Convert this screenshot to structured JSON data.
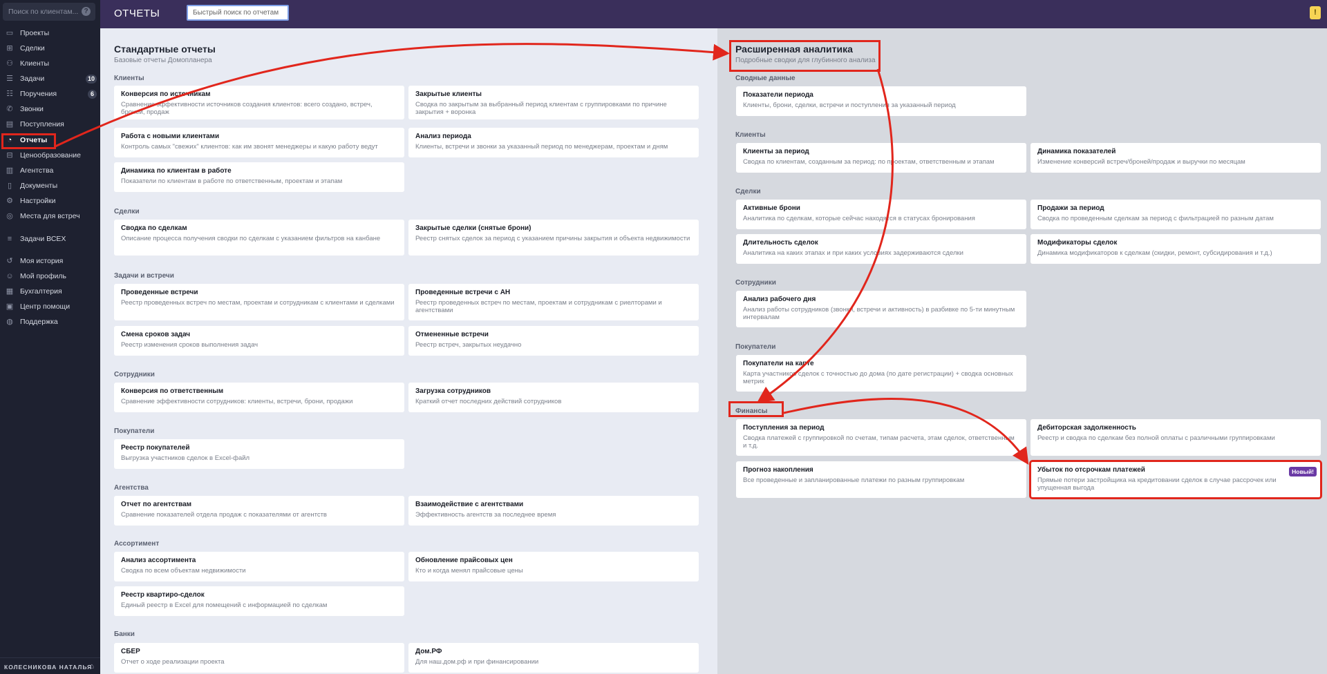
{
  "sidebar": {
    "search_placeholder": "Поиск по клиентам...",
    "items": [
      {
        "label": "Проекты",
        "icon": "folder-icon"
      },
      {
        "label": "Сделки",
        "icon": "handshake-icon"
      },
      {
        "label": "Клиенты",
        "icon": "users-icon"
      },
      {
        "label": "Задачи",
        "icon": "tasks-icon",
        "badge": "10"
      },
      {
        "label": "Поручения",
        "icon": "assignment-icon",
        "badge": "6"
      },
      {
        "label": "Звонки",
        "icon": "phone-icon"
      },
      {
        "label": "Поступления",
        "icon": "wallet-icon"
      },
      {
        "label": "Отчеты",
        "icon": "chart-pie-icon",
        "active": true
      },
      {
        "label": "Ценообразование",
        "icon": "price-tag-icon"
      },
      {
        "label": "Агентства",
        "icon": "building-icon"
      },
      {
        "label": "Документы",
        "icon": "document-icon"
      },
      {
        "label": "Настройки",
        "icon": "gear-icon"
      },
      {
        "label": "Места для встреч",
        "icon": "location-icon"
      },
      {
        "label": "Задачи ВСЕХ",
        "icon": "list-icon"
      },
      {
        "label": "Моя история",
        "icon": "history-icon"
      },
      {
        "label": "Мой профиль",
        "icon": "profile-icon"
      },
      {
        "label": "Бухгалтерия",
        "icon": "calculator-icon"
      },
      {
        "label": "Центр помощи",
        "icon": "help-center-icon"
      },
      {
        "label": "Поддержка",
        "icon": "globe-icon"
      }
    ],
    "footer_user": "КОЛЕСНИКОВА НАТАЛЬЯ"
  },
  "topbar": {
    "title": "ОТЧЕТЫ",
    "search_placeholder": "Быстрый поиск по отчетам"
  },
  "standard": {
    "title": "Стандартные отчеты",
    "subtitle": "Базовые отчеты Домопланера",
    "sections": {
      "clients": "Клиенты",
      "deals": "Сделки",
      "tasks": "Задачи и встречи",
      "staff": "Сотрудники",
      "buyers": "Покупатели",
      "agencies": "Агентства",
      "assortment": "Ассортимент",
      "banks": "Банки"
    },
    "cards": {
      "c1": {
        "title": "Конверсия по источникам",
        "desc": "Сравнение эффективности источников создания клиентов: всего создано, встреч, броней, продаж"
      },
      "c2": {
        "title": "Закрытые клиенты",
        "desc": "Сводка по закрытым за выбранный период клиентам с группировками по причине закрытия + воронка"
      },
      "c3": {
        "title": "Работа с новыми клиентами",
        "desc": "Контроль самых \"свежих\" клиентов: как им звонят менеджеры и какую работу ведут"
      },
      "c4": {
        "title": "Анализ периода",
        "desc": "Клиенты, встречи и звонки за указанный период по менеджерам, проектам и дням"
      },
      "c5": {
        "title": "Динамика по клиентам в работе",
        "desc": "Показатели по клиентам в работе по ответственным, проектам и этапам"
      },
      "d1": {
        "title": "Сводка по сделкам",
        "desc": "Описание процесса получения сводки по сделкам с указанием фильтров на канбане"
      },
      "d2": {
        "title": "Закрытые сделки (снятые брони)",
        "desc": "Реестр снятых сделок за период с указанием причины закрытия и объекта недвижимости"
      },
      "t1": {
        "title": "Проведенные встречи",
        "desc": "Реестр проведенных встреч по местам, проектам и сотрудникам с клиентами и сделками"
      },
      "t2": {
        "title": "Проведенные встречи с АН",
        "desc": "Реестр проведенных встреч по местам, проектам и сотрудникам с риелторами и агентствами"
      },
      "t3": {
        "title": "Смена сроков задач",
        "desc": "Реестр изменения сроков выполнения задач"
      },
      "t4": {
        "title": "Отмененные встречи",
        "desc": "Реестр встреч, закрытых неудачно"
      },
      "s1": {
        "title": "Конверсия по ответственным",
        "desc": "Сравнение эффективности сотрудников: клиенты, встречи, брони, продажи"
      },
      "s2": {
        "title": "Загрузка сотрудников",
        "desc": "Краткий отчет последних действий сотрудников"
      },
      "b1": {
        "title": "Реестр покупателей",
        "desc": "Выгрузка участников сделок в Excel-файл"
      },
      "a1": {
        "title": "Отчет по агентствам",
        "desc": "Сравнение показателей отдела продаж с показателями от агентств"
      },
      "a2": {
        "title": "Взаимодействие с агентствами",
        "desc": "Эффективность агентств за последнее время"
      },
      "r1": {
        "title": "Анализ ассортимента",
        "desc": "Сводка по всем объектам недвижимости"
      },
      "r2": {
        "title": "Обновление прайсовых цен",
        "desc": "Кто и когда менял прайсовые цены"
      },
      "r3": {
        "title": "Реестр квартиро-сделок",
        "desc": "Единый реестр в Excel для помещений с информацией по сделкам"
      },
      "k1": {
        "title": "СБЕР",
        "desc": "Отчет о ходе реализации проекта"
      },
      "k2": {
        "title": "Дом.РФ",
        "desc": "Для наш.дом.рф и при финансировании"
      }
    }
  },
  "advanced": {
    "title": "Расширенная аналитика",
    "subtitle": "Подробные сводки для глубинного анализа",
    "sections": {
      "summary": "Сводные данные",
      "clients": "Клиенты",
      "deals": "Сделки",
      "staff": "Сотрудники",
      "buyers": "Покупатели",
      "finance": "Финансы"
    },
    "cards": {
      "p1": {
        "title": "Показатели периода",
        "desc": "Клиенты, брони, сделки, встречи и поступления за указанный период"
      },
      "cl1": {
        "title": "Клиенты за период",
        "desc": "Сводка по клиентам, созданным за период: по проектам, ответственным и этапам"
      },
      "cl2": {
        "title": "Динамика показателей",
        "desc": "Изменение конверсий встреч/броней/продаж и выручки по месяцам"
      },
      "dl1": {
        "title": "Активные брони",
        "desc": "Аналитика по сделкам, которые сейчас находятся в статусах бронирования"
      },
      "dl2": {
        "title": "Продажи за период",
        "desc": "Сводка по проведенным сделкам за период с фильтрацией по разным датам"
      },
      "dl3": {
        "title": "Длительность сделок",
        "desc": "Аналитика на каких этапах и при каких условиях задерживаются сделки"
      },
      "dl4": {
        "title": "Модификаторы сделок",
        "desc": "Динамика модификаторов к сделкам (скидки, ремонт, субсидирования и т.д.)"
      },
      "st1": {
        "title": "Анализ рабочего дня",
        "desc": "Анализ работы сотрудников (звонки, встречи и активность) в разбивке по 5-ти минутным интервалам"
      },
      "by1": {
        "title": "Покупатели на карте",
        "desc": "Карта участников сделок с точностью до дома (по дате регистрации) + сводка основных метрик"
      },
      "f1": {
        "title": "Поступления за период",
        "desc": "Сводка платежей с группировкой по счетам, типам расчета, этам сделок, ответственным и т.д."
      },
      "f2": {
        "title": "Дебиторская задолженность",
        "desc": "Реестр и сводка по сделкам без полной оплаты с различными группировками"
      },
      "f3": {
        "title": "Прогноз накопления",
        "desc": "Все проведенные и запланированные платежи по разным группировкам"
      },
      "f4": {
        "title": "Убыток по отсрочкам платежей",
        "desc": "Прямые потери застройщика на кредитовании сделок в случае рассрочек или упущенная выгода",
        "badge": "Новый!"
      }
    }
  },
  "colors": {
    "sidebar_bg": "#1e2130",
    "topbar_bg": "#3a2f5b",
    "highlight_red": "#e1261c",
    "badge_purple": "#6a3aa5"
  }
}
